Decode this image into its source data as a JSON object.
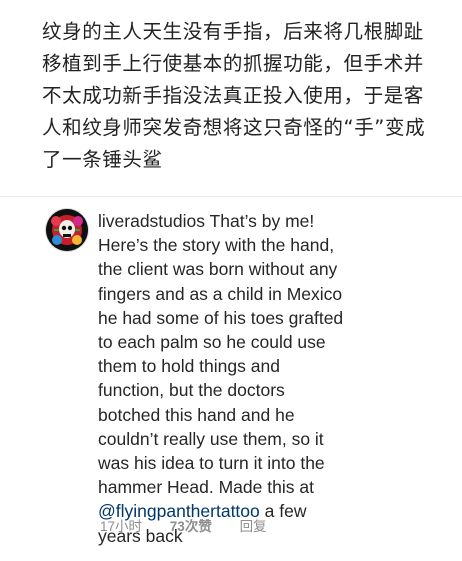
{
  "caption": {
    "lines": [
      "纹身的主人天生没有手指，后来将几根脚趾",
      "移植到手上行使基本的抓握功能，但手术并",
      "不太成功新手指没法真正投入使用，于是客",
      "人和纹身师突发奇想将这只奇怪的“手”变成",
      "了一条锤头鲨"
    ]
  },
  "comment": {
    "username": "liveradstudios",
    "lines": [
      "That’s by me!",
      "Here’s the story with the hand,",
      "the client was born without any",
      "fingers and as a child in Mexico",
      "he had some of his toes grafted",
      "to each palm so he could use",
      "them to hold things and",
      "function, but the doctors",
      "botched this hand and he",
      "couldn’t really use them, so it",
      "was his idea to turn it into the",
      "hammer Head. Made this at"
    ],
    "mention": "@flyingpanthertattoo",
    "after_mention": " a few",
    "last_line": "years back",
    "meta": {
      "time": "17小时",
      "likes": "73次赞",
      "reply": "回复"
    },
    "colors": {
      "text": "#262626",
      "mention": "#00376b",
      "meta": "#8e8e8e"
    },
    "avatar_icon": "skull-flower-avatar"
  }
}
